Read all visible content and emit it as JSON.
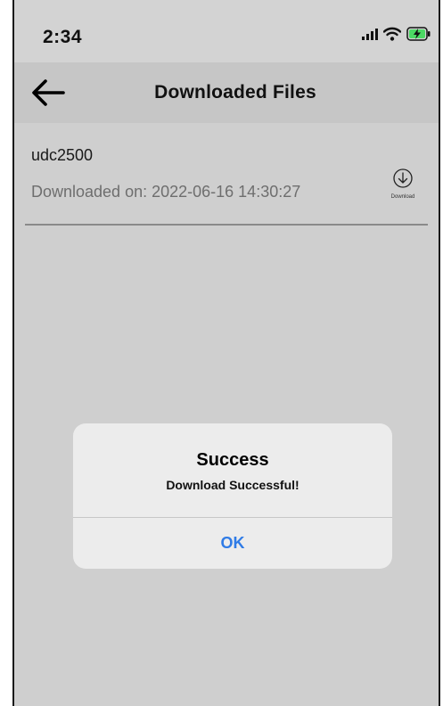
{
  "status_bar": {
    "time": "2:34",
    "icons": [
      "signal-icon",
      "wifi-icon",
      "battery-charging-icon"
    ]
  },
  "nav": {
    "back_icon": "arrow-left-icon",
    "title": "Downloaded Files"
  },
  "files": [
    {
      "name": "udc2500",
      "downloaded_on": "Downloaded on: 2022-06-16 14:30:27",
      "action_icon": "download-circle-icon",
      "action_label": "Download"
    }
  ],
  "dialog": {
    "title": "Success",
    "message": "Download Successful!",
    "ok_label": "OK",
    "ok_color": "#2f7be6"
  },
  "colors": {
    "background": "#cfcfcf",
    "navbar": "#c6c6c6",
    "dialog": "#ececec",
    "battery": "#4cd964"
  }
}
